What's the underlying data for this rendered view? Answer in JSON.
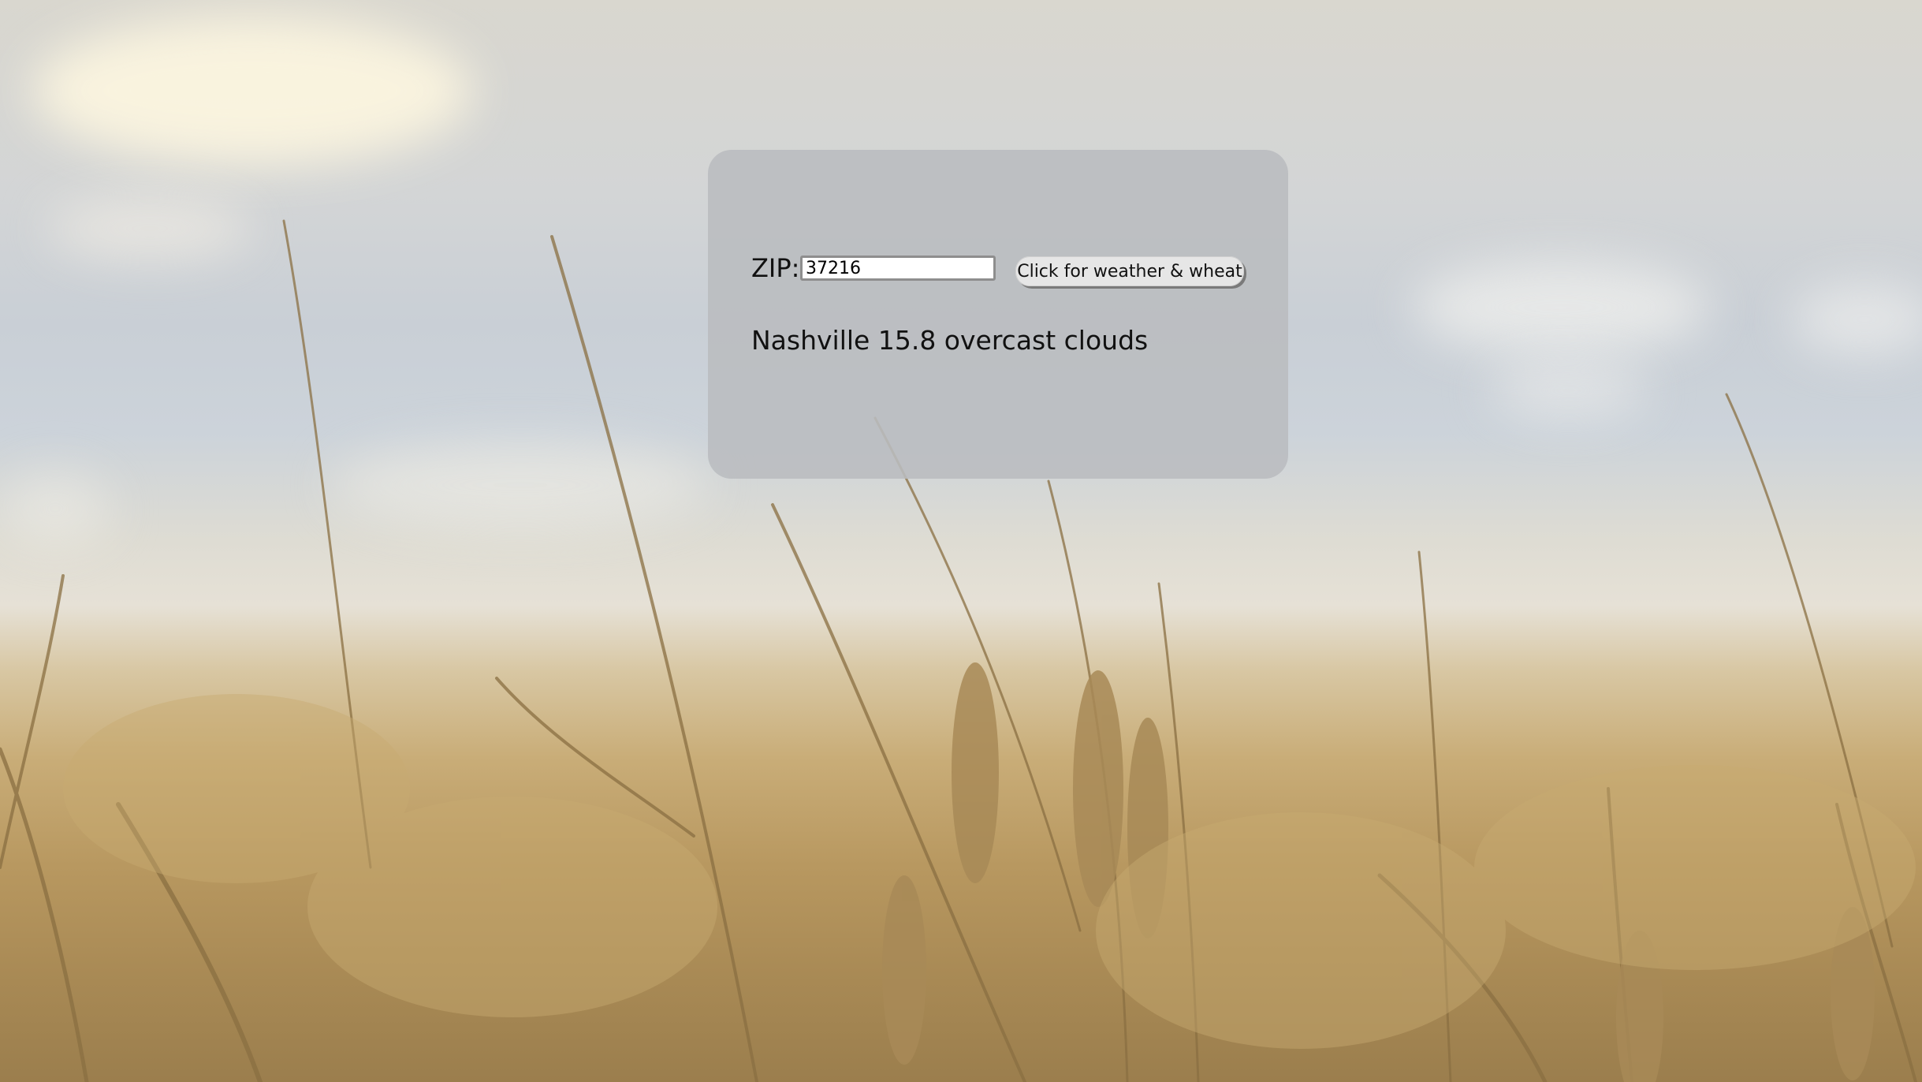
{
  "form": {
    "zip_label": "ZIP:",
    "zip_value": "37216",
    "button_label": "Click for weather & wheat"
  },
  "result": {
    "text": "Nashville 15.8 overcast clouds"
  },
  "background": {
    "description_icon": "wheat-field-background"
  }
}
